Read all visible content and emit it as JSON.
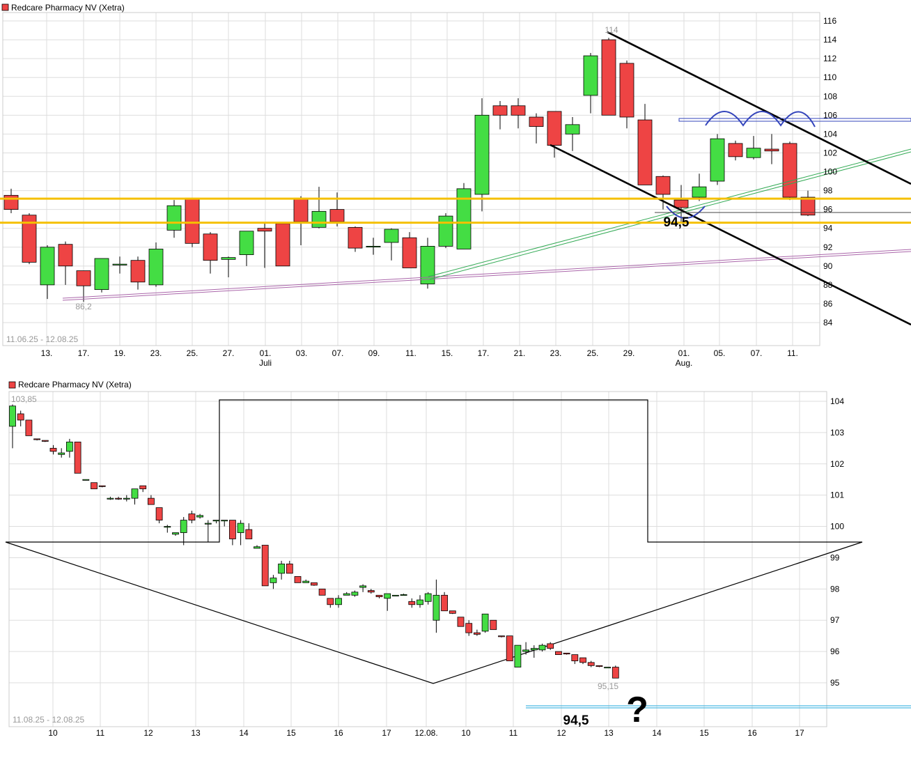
{
  "colors": {
    "up": "#44dd44",
    "down": "#ee4444",
    "grid": "#dddddd",
    "support": "#f5c000",
    "channel": "#000000",
    "arcs": "#3344bb",
    "green_trend": "#33aa55",
    "purple_trend": "#aa66aa",
    "blue_line": "#3344bb",
    "cyan_line": "#22aadd",
    "faint_label": "#999999"
  },
  "chart_data": [
    {
      "type": "candlestick",
      "title": "Redcare Pharmacy NV (Xetra)",
      "date_range": "11.06.25 - 12.08.25",
      "ylim": [
        82,
        117
      ],
      "y_ticks": [
        84,
        86,
        88,
        90,
        92,
        94,
        96,
        98,
        100,
        102,
        104,
        106,
        108,
        110,
        112,
        114,
        116
      ],
      "x_tick_labels": [
        "13.",
        "17.",
        "19.",
        "23.",
        "25.",
        "27.",
        "01.",
        "03.",
        "07.",
        "09.",
        "11.",
        "15.",
        "17.",
        "21.",
        "23.",
        "25.",
        "29.",
        "01.",
        "05.",
        "07.",
        "11."
      ],
      "x_month_labels": [
        "Juli",
        "Aug."
      ],
      "candles": [
        {
          "o": 97.5,
          "h": 98.2,
          "l": 95.6,
          "c": 96.0
        },
        {
          "o": 95.4,
          "h": 95.6,
          "l": 90.2,
          "c": 90.4
        },
        {
          "o": 88.0,
          "h": 92.2,
          "l": 86.5,
          "c": 92.0
        },
        {
          "o": 92.3,
          "h": 92.6,
          "l": 88.0,
          "c": 90.0
        },
        {
          "o": 89.5,
          "h": 89.5,
          "l": 86.2,
          "c": 87.9
        },
        {
          "o": 87.5,
          "h": 90.8,
          "l": 87.2,
          "c": 90.8
        },
        {
          "o": 90.1,
          "h": 91.0,
          "l": 89.2,
          "c": 90.2
        },
        {
          "o": 90.6,
          "h": 91.0,
          "l": 87.5,
          "c": 88.3
        },
        {
          "o": 88.0,
          "h": 92.5,
          "l": 87.8,
          "c": 91.8
        },
        {
          "o": 93.8,
          "h": 97.0,
          "l": 93.0,
          "c": 96.4
        },
        {
          "o": 97.2,
          "h": 97.2,
          "l": 92.0,
          "c": 92.4
        },
        {
          "o": 93.4,
          "h": 93.6,
          "l": 89.2,
          "c": 90.6
        },
        {
          "o": 90.7,
          "h": 91.0,
          "l": 88.8,
          "c": 90.9
        },
        {
          "o": 91.2,
          "h": 93.7,
          "l": 90.0,
          "c": 93.7
        },
        {
          "o": 94.0,
          "h": 94.6,
          "l": 89.8,
          "c": 93.7
        },
        {
          "o": 94.5,
          "h": 94.6,
          "l": 90.0,
          "c": 90.0
        },
        {
          "o": 97.2,
          "h": 97.4,
          "l": 92.2,
          "c": 94.7
        },
        {
          "o": 94.1,
          "h": 98.4,
          "l": 94.0,
          "c": 95.8
        },
        {
          "o": 96.0,
          "h": 97.8,
          "l": 94.2,
          "c": 94.7
        },
        {
          "o": 94.1,
          "h": 94.2,
          "l": 91.5,
          "c": 91.9
        },
        {
          "o": 92.1,
          "h": 93.0,
          "l": 91.2,
          "c": 92.1
        },
        {
          "o": 92.5,
          "h": 94.0,
          "l": 90.6,
          "c": 93.9
        },
        {
          "o": 93.0,
          "h": 93.6,
          "l": 89.8,
          "c": 89.8
        },
        {
          "o": 88.1,
          "h": 93.0,
          "l": 87.6,
          "c": 92.1
        },
        {
          "o": 92.1,
          "h": 95.6,
          "l": 91.9,
          "c": 95.3
        },
        {
          "o": 91.8,
          "h": 98.8,
          "l": 91.8,
          "c": 98.2
        },
        {
          "o": 97.6,
          "h": 107.8,
          "l": 95.8,
          "c": 106.0
        },
        {
          "o": 107.0,
          "h": 107.5,
          "l": 104.5,
          "c": 106.0
        },
        {
          "o": 107.0,
          "h": 107.8,
          "l": 104.6,
          "c": 106.0
        },
        {
          "o": 105.8,
          "h": 106.2,
          "l": 103.0,
          "c": 104.8
        },
        {
          "o": 106.4,
          "h": 106.4,
          "l": 101.5,
          "c": 102.8
        },
        {
          "o": 104.0,
          "h": 105.8,
          "l": 102.2,
          "c": 105.0
        },
        {
          "o": 108.1,
          "h": 112.6,
          "l": 106.2,
          "c": 112.3
        },
        {
          "o": 114.0,
          "h": 114.2,
          "l": 106.0,
          "c": 106.0
        },
        {
          "o": 111.5,
          "h": 111.8,
          "l": 104.6,
          "c": 105.8
        },
        {
          "o": 105.5,
          "h": 107.2,
          "l": 98.6,
          "c": 98.6
        },
        {
          "o": 99.5,
          "h": 99.6,
          "l": 96.0,
          "c": 97.6
        },
        {
          "o": 97.0,
          "h": 98.6,
          "l": 94.5,
          "c": 96.2
        },
        {
          "o": 97.3,
          "h": 99.8,
          "l": 96.9,
          "c": 98.4
        },
        {
          "o": 99.0,
          "h": 104.0,
          "l": 98.6,
          "c": 103.5
        },
        {
          "o": 103.0,
          "h": 103.3,
          "l": 101.2,
          "c": 101.6
        },
        {
          "o": 101.5,
          "h": 103.8,
          "l": 101.3,
          "c": 102.5
        },
        {
          "o": 102.4,
          "h": 104.0,
          "l": 100.8,
          "c": 102.2
        },
        {
          "o": 103.0,
          "h": 103.2,
          "l": 97.0,
          "c": 97.3
        },
        {
          "o": 97.3,
          "h": 98.0,
          "l": 95.3,
          "c": 95.4
        }
      ],
      "support_lines": [
        97.15,
        94.6
      ],
      "horizontal_marker": 94.4,
      "resistance_band": [
        104.2,
        104.6
      ],
      "annotations": {
        "high_label": "114",
        "low_label": "86,2",
        "target_label": "94,5"
      }
    },
    {
      "type": "candlestick",
      "title": "Redcare Pharmacy NV (Xetra)",
      "date_range": "11.08.25 - 12.08.25",
      "ylim": [
        94.2,
        104.4
      ],
      "y_ticks": [
        95,
        96,
        97,
        98,
        99,
        100,
        101,
        102,
        103,
        104
      ],
      "x_tick_labels": [
        "10",
        "11",
        "12",
        "13",
        "14",
        "15",
        "16",
        "17",
        "12.08.",
        "10",
        "11",
        "12",
        "13",
        "14",
        "15",
        "16",
        "17"
      ],
      "candles": [
        {
          "o": 103.2,
          "h": 103.9,
          "l": 102.5,
          "c": 103.85
        },
        {
          "o": 103.6,
          "h": 103.7,
          "l": 103.2,
          "c": 103.4
        },
        {
          "o": 103.4,
          "h": 103.4,
          "l": 102.9,
          "c": 102.9
        },
        {
          "o": 102.8,
          "h": 102.8,
          "l": 102.75,
          "c": 102.78
        },
        {
          "o": 102.75,
          "h": 102.75,
          "l": 102.7,
          "c": 102.72
        },
        {
          "o": 102.5,
          "h": 102.6,
          "l": 102.3,
          "c": 102.4
        },
        {
          "o": 102.3,
          "h": 102.5,
          "l": 102.2,
          "c": 102.35
        },
        {
          "o": 102.4,
          "h": 102.8,
          "l": 102.2,
          "c": 102.7
        },
        {
          "o": 102.7,
          "h": 102.7,
          "l": 101.7,
          "c": 101.7
        },
        {
          "o": 101.5,
          "h": 101.5,
          "l": 101.5,
          "c": 101.5
        },
        {
          "o": 101.4,
          "h": 101.4,
          "l": 101.2,
          "c": 101.2
        },
        {
          "o": 101.3,
          "h": 101.3,
          "l": 101.25,
          "c": 101.28
        },
        {
          "o": 100.9,
          "h": 100.95,
          "l": 100.85,
          "c": 100.9
        },
        {
          "o": 100.9,
          "h": 100.95,
          "l": 100.85,
          "c": 100.88
        },
        {
          "o": 100.9,
          "h": 101.0,
          "l": 100.8,
          "c": 100.9
        },
        {
          "o": 100.9,
          "h": 101.2,
          "l": 100.7,
          "c": 101.2
        },
        {
          "o": 101.3,
          "h": 101.3,
          "l": 101.1,
          "c": 101.2
        },
        {
          "o": 100.9,
          "h": 101.0,
          "l": 100.7,
          "c": 100.7
        },
        {
          "o": 100.6,
          "h": 100.6,
          "l": 100.1,
          "c": 100.2
        },
        {
          "o": 100.0,
          "h": 100.05,
          "l": 99.8,
          "c": 100.0
        },
        {
          "o": 99.75,
          "h": 99.8,
          "l": 99.7,
          "c": 99.8
        },
        {
          "o": 99.8,
          "h": 100.3,
          "l": 99.4,
          "c": 100.2
        },
        {
          "o": 100.4,
          "h": 100.5,
          "l": 100.1,
          "c": 100.2
        },
        {
          "o": 100.3,
          "h": 100.4,
          "l": 100.25,
          "c": 100.35
        },
        {
          "o": 100.1,
          "h": 100.2,
          "l": 99.5,
          "c": 100.1
        },
        {
          "o": 100.2,
          "h": 100.2,
          "l": 100.1,
          "c": 100.2
        },
        {
          "o": 100.2,
          "h": 100.2,
          "l": 100.0,
          "c": 100.2
        },
        {
          "o": 100.2,
          "h": 100.2,
          "l": 99.4,
          "c": 99.6
        },
        {
          "o": 99.8,
          "h": 100.2,
          "l": 99.4,
          "c": 100.1
        },
        {
          "o": 99.9,
          "h": 100.1,
          "l": 99.6,
          "c": 99.6
        },
        {
          "o": 99.3,
          "h": 99.4,
          "l": 99.3,
          "c": 99.35
        },
        {
          "o": 99.4,
          "h": 99.4,
          "l": 98.1,
          "c": 98.1
        },
        {
          "o": 98.2,
          "h": 98.45,
          "l": 98.0,
          "c": 98.35
        },
        {
          "o": 98.5,
          "h": 98.9,
          "l": 98.3,
          "c": 98.8
        },
        {
          "o": 98.8,
          "h": 98.9,
          "l": 98.5,
          "c": 98.5
        },
        {
          "o": 98.4,
          "h": 98.4,
          "l": 98.2,
          "c": 98.2
        },
        {
          "o": 98.2,
          "h": 98.3,
          "l": 98.2,
          "c": 98.25
        },
        {
          "o": 98.2,
          "h": 98.2,
          "l": 98.1,
          "c": 98.12
        },
        {
          "o": 98.0,
          "h": 98.0,
          "l": 97.8,
          "c": 97.8
        },
        {
          "o": 97.7,
          "h": 97.7,
          "l": 97.4,
          "c": 97.5
        },
        {
          "o": 97.5,
          "h": 97.8,
          "l": 97.4,
          "c": 97.7
        },
        {
          "o": 97.8,
          "h": 97.9,
          "l": 97.8,
          "c": 97.85
        },
        {
          "o": 97.8,
          "h": 97.95,
          "l": 97.75,
          "c": 97.9
        },
        {
          "o": 98.05,
          "h": 98.15,
          "l": 97.9,
          "c": 98.1
        },
        {
          "o": 97.95,
          "h": 98.0,
          "l": 97.85,
          "c": 97.9
        },
        {
          "o": 97.8,
          "h": 97.8,
          "l": 97.7,
          "c": 97.75
        },
        {
          "o": 97.7,
          "h": 97.85,
          "l": 97.3,
          "c": 97.85
        },
        {
          "o": 97.8,
          "h": 97.8,
          "l": 97.8,
          "c": 97.8
        },
        {
          "o": 97.8,
          "h": 97.85,
          "l": 97.8,
          "c": 97.82
        },
        {
          "o": 97.6,
          "h": 97.7,
          "l": 97.4,
          "c": 97.5
        },
        {
          "o": 97.5,
          "h": 97.8,
          "l": 97.4,
          "c": 97.65
        },
        {
          "o": 97.6,
          "h": 97.9,
          "l": 97.5,
          "c": 97.85
        },
        {
          "o": 97.0,
          "h": 98.3,
          "l": 96.6,
          "c": 97.8
        },
        {
          "o": 97.8,
          "h": 97.9,
          "l": 97.3,
          "c": 97.3
        },
        {
          "o": 97.3,
          "h": 97.3,
          "l": 97.2,
          "c": 97.22
        },
        {
          "o": 97.1,
          "h": 97.1,
          "l": 96.8,
          "c": 96.8
        },
        {
          "o": 96.9,
          "h": 97.0,
          "l": 96.5,
          "c": 96.6
        },
        {
          "o": 96.6,
          "h": 96.7,
          "l": 96.5,
          "c": 96.55
        },
        {
          "o": 96.65,
          "h": 97.2,
          "l": 96.6,
          "c": 97.2
        },
        {
          "o": 97.0,
          "h": 97.0,
          "l": 96.7,
          "c": 96.7
        },
        {
          "o": 96.5,
          "h": 96.5,
          "l": 96.45,
          "c": 96.48
        },
        {
          "o": 96.5,
          "h": 96.5,
          "l": 95.7,
          "c": 95.7
        },
        {
          "o": 95.5,
          "h": 96.2,
          "l": 95.5,
          "c": 96.2
        },
        {
          "o": 96.0,
          "h": 96.3,
          "l": 95.9,
          "c": 96.05
        },
        {
          "o": 96.05,
          "h": 96.2,
          "l": 95.8,
          "c": 96.1
        },
        {
          "o": 96.05,
          "h": 96.25,
          "l": 96.0,
          "c": 96.2
        },
        {
          "o": 96.25,
          "h": 96.3,
          "l": 96.05,
          "c": 96.1
        },
        {
          "o": 96.0,
          "h": 96.0,
          "l": 95.9,
          "c": 95.9
        },
        {
          "o": 95.95,
          "h": 95.95,
          "l": 95.9,
          "c": 95.92
        },
        {
          "o": 95.9,
          "h": 95.9,
          "l": 95.6,
          "c": 95.7
        },
        {
          "o": 95.8,
          "h": 95.8,
          "l": 95.6,
          "c": 95.65
        },
        {
          "o": 95.65,
          "h": 95.7,
          "l": 95.5,
          "c": 95.55
        },
        {
          "o": 95.55,
          "h": 95.55,
          "l": 95.5,
          "c": 95.52
        },
        {
          "o": 95.5,
          "h": 95.5,
          "l": 95.5,
          "c": 95.5
        },
        {
          "o": 95.5,
          "h": 95.55,
          "l": 95.15,
          "c": 95.15
        }
      ],
      "horizontal_marker": 94.5,
      "annotations": {
        "high_label": "103,85",
        "low_label": "95,15",
        "target_label": "94,5",
        "question_mark": "?"
      }
    }
  ]
}
